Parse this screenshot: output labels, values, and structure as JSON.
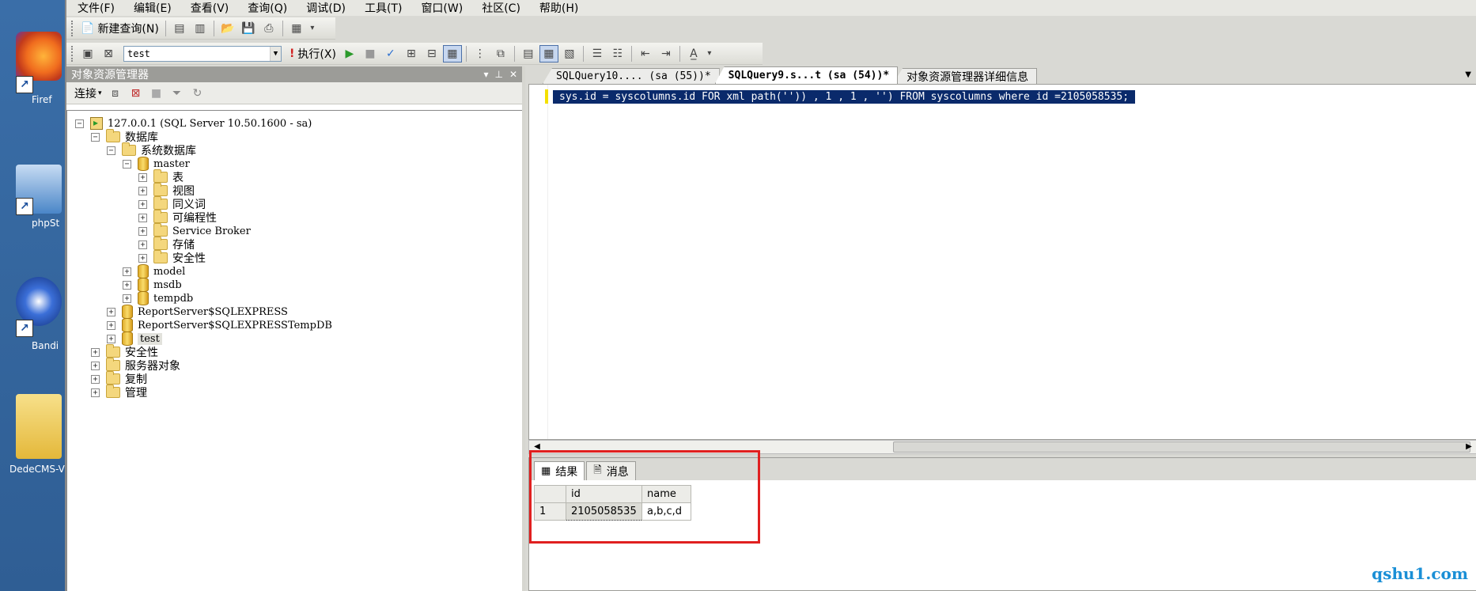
{
  "desktop": {
    "icons": [
      {
        "label": "Firef",
        "name": "firefox"
      },
      {
        "label": "phpSt",
        "name": "phpstudy"
      },
      {
        "label": "Bandi",
        "name": "bandizip"
      },
      {
        "label": "DedeCMS-V",
        "name": "dedecms-folder"
      }
    ]
  },
  "menu": [
    "文件(F)",
    "编辑(E)",
    "查看(V)",
    "查询(Q)",
    "调试(D)",
    "工具(T)",
    "窗口(W)",
    "社区(C)",
    "帮助(H)"
  ],
  "toolbar": {
    "new_query": "新建查询(N)",
    "database": "test",
    "execute": "执行(X)"
  },
  "object_explorer": {
    "title": "对象资源管理器",
    "connect": "连接",
    "tree": {
      "server": "127.0.0.1 (SQL Server 10.50.1600 - sa)",
      "databases": "数据库",
      "system_databases": "系统数据库",
      "master": "master",
      "master_children": [
        "表",
        "视图",
        "同义词",
        "可编程性",
        "Service Broker",
        "存储",
        "安全性"
      ],
      "model": "model",
      "msdb": "msdb",
      "tempdb": "tempdb",
      "report_server": "ReportServer$SQLEXPRESS",
      "report_server_temp": "ReportServer$SQLEXPRESSTempDB",
      "test": "test",
      "security": "安全性",
      "server_objects": "服务器对象",
      "replication": "复制",
      "management": "管理"
    }
  },
  "editor": {
    "tabs": [
      {
        "label": "SQLQuery10....  (sa (55))*",
        "active": false
      },
      {
        "label": "SQLQuery9.s...t (sa (54))*",
        "active": true
      },
      {
        "label": "对象资源管理器详细信息",
        "active": false
      }
    ],
    "code": "sys.id = syscolumns.id FOR xml path('')) , 1 , 1 , '') FROM syscolumns where id =2105058535;"
  },
  "results": {
    "tabs": [
      {
        "label": "结果",
        "active": true
      },
      {
        "label": "消息",
        "active": false
      }
    ],
    "columns": [
      "id",
      "name"
    ],
    "rows": [
      {
        "num": "1",
        "id": "2105058535",
        "name": "a,b,c,d"
      }
    ]
  },
  "watermark": "qshu1.com"
}
